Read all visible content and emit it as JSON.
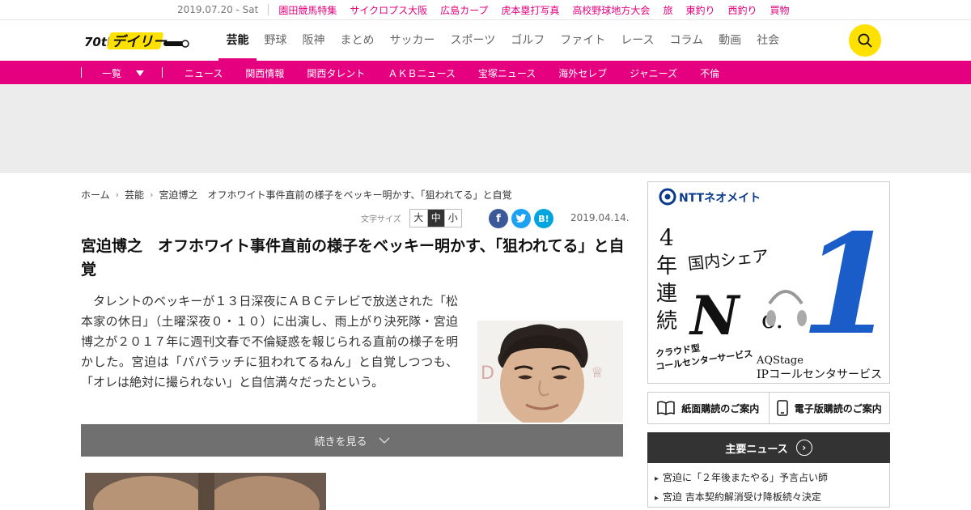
{
  "topbar": {
    "date": "2019.07.20 - Sat",
    "links": [
      "園田競馬特集",
      "サイクロプス大阪",
      "広島カープ",
      "虎本塁打写真",
      "高校野球地方大会",
      "旅",
      "東釣り",
      "西釣り",
      "買物"
    ]
  },
  "header": {
    "logo_text": "デイリー",
    "logo_badge": "70th",
    "nav": [
      "芸能",
      "野球",
      "阪神",
      "まとめ",
      "サッカー",
      "スポーツ",
      "ゴルフ",
      "ファイト",
      "レース",
      "コラム",
      "動画",
      "社会"
    ],
    "active_nav": "芸能",
    "search_icon": "search-icon"
  },
  "subnav": {
    "menu_label": "一覧",
    "links": [
      "ニュース",
      "関西情報",
      "関西タレント",
      "ＡＫＢニュース",
      "宝塚ニュース",
      "海外セレブ",
      "ジャニーズ",
      "不倫"
    ]
  },
  "breadcrumb": [
    "ホーム",
    "芸能",
    "宮迫博之　オフホワイト事件直前の様子をベッキー明かす、「狙われてる」と自覚"
  ],
  "article": {
    "font_size_label": "文字サイズ",
    "font_sizes": [
      "大",
      "中",
      "小"
    ],
    "font_size_selected": "中",
    "share": {
      "facebook": "f",
      "twitter": "t",
      "hatena": "B!"
    },
    "date": "2019.04.14.",
    "title": "宮迫博之　オフホワイト事件直前の様子をベッキー明かす、「狙われてる」と自覚",
    "body": "タレントのベッキーが１３日深夜にＡＢＣテレビで放送された「松本家の休日」（土曜深夜０・１０）に出演し、雨上がり決死隊・宮迫博之が２０１７年に週刊文春で不倫疑惑を報じられる直前の様子を明かした。宮迫は「パパラッチに狙われてるねん」と自覚しつつも、「オレは絶対に撮られない」と自信満々だったという。",
    "more_label": "続きを見る"
  },
  "sidebar": {
    "ad": {
      "brand": "NTTネオメイト",
      "years": "4年連続",
      "share": "国内シェア",
      "rank": "No.1",
      "product_left": "クラウド型\nコールセンターサービス",
      "product_right": "AQStage\nIPコールセンタサービス"
    },
    "subscriptions": [
      "紙面購読のご案内",
      "電子版購読のご案内"
    ],
    "main_news": {
      "title": "主要ニュース",
      "items": [
        "宮迫に「２年後またやる」予言占い師",
        "宮迫 吉本契約解消受け降板続々決定"
      ]
    }
  },
  "colors": {
    "brand_pink": "#e4007f",
    "search_yellow": "#ffe100",
    "facebook": "#3b5998",
    "twitter": "#1da1f2",
    "hatena": "#00a4de"
  }
}
